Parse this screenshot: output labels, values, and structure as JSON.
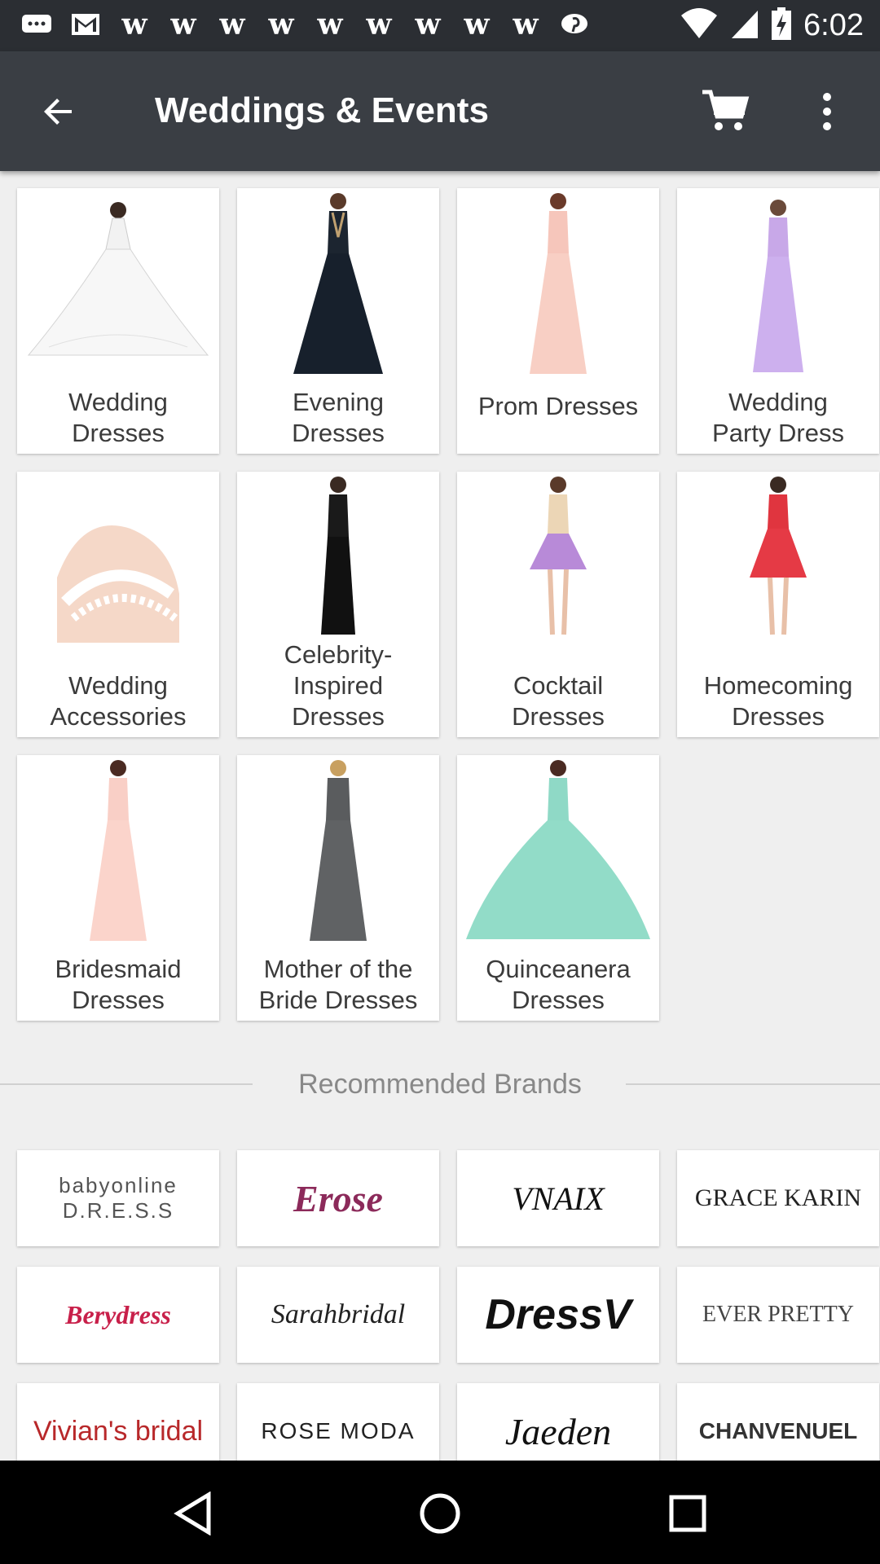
{
  "status_bar": {
    "time": "6:02"
  },
  "toolbar": {
    "title": "Weddings & Events",
    "back_icon": "arrow-back-icon",
    "cart_icon": "shopping-cart-icon",
    "menu_icon": "more-vert-icon"
  },
  "categories": [
    {
      "label": "Wedding\nDresses"
    },
    {
      "label": "Evening\nDresses"
    },
    {
      "label": "Prom Dresses"
    },
    {
      "label": "Wedding\nParty Dress"
    },
    {
      "label": "Wedding\nAccessories"
    },
    {
      "label": "Celebrity-\nInspired\nDresses"
    },
    {
      "label": "Cocktail\nDresses"
    },
    {
      "label": "Homecoming\nDresses"
    },
    {
      "label": "Bridesmaid\nDresses"
    },
    {
      "label": "Mother of the\nBride Dresses"
    },
    {
      "label": "Quinceanera\nDresses"
    }
  ],
  "recommended": {
    "title": "Recommended Brands"
  },
  "brands": [
    {
      "name": "babyonline D.R.E.S.S"
    },
    {
      "name": "Erose"
    },
    {
      "name": "VNAIX"
    },
    {
      "name": "GRACE KARIN"
    },
    {
      "name": "Berydress"
    },
    {
      "name": "Sarahbridal"
    },
    {
      "name": "DressV"
    },
    {
      "name": "EVER PRETTY"
    },
    {
      "name": "Vivian's bridal"
    },
    {
      "name": "ROSE MODA"
    },
    {
      "name": "Jaeden"
    },
    {
      "name": "CHANVENUEL"
    }
  ],
  "nav_bar": {
    "back_icon": "nav-back-icon",
    "home_icon": "nav-home-icon",
    "recents_icon": "nav-recents-icon"
  }
}
